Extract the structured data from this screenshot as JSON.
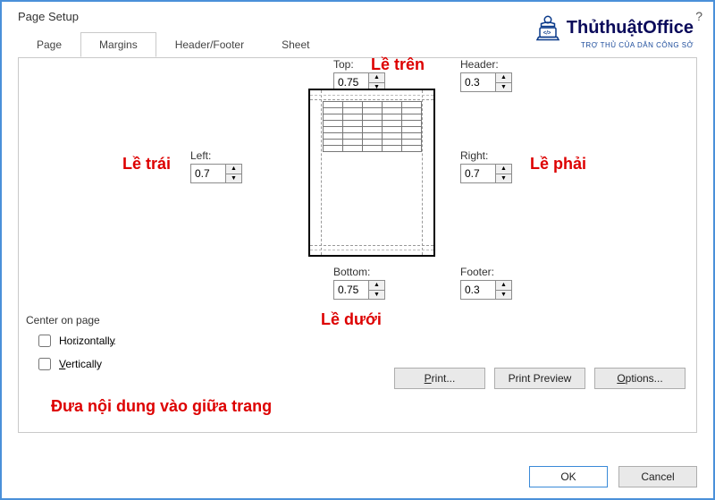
{
  "window": {
    "title": "Page Setup",
    "help": "?",
    "close": "✕"
  },
  "logo": {
    "brand": "ThủthuậtOffice",
    "tagline": "TRỢ THỦ CỦA DÂN CÔNG SỞ"
  },
  "tabs": {
    "page": "Page",
    "margins": "Margins",
    "headerfooter": "Header/Footer",
    "sheet": "Sheet"
  },
  "fields": {
    "top": {
      "label": "Top:",
      "value": "0.75"
    },
    "header": {
      "label": "Header:",
      "value": "0.3"
    },
    "left": {
      "label": "Left:",
      "value": "0.7"
    },
    "right": {
      "label": "Right:",
      "value": "0.7"
    },
    "bottom": {
      "label": "Bottom:",
      "value": "0.75"
    },
    "footer": {
      "label": "Footer:",
      "value": "0.3"
    }
  },
  "annotations": {
    "top": "Lề trên",
    "left": "Lề trái",
    "right": "Lề phải",
    "bottom": "Lề dưới",
    "center": "Đưa nội dung vào giữa trang"
  },
  "center": {
    "legend": "Center on page",
    "horizontally": "Horizontally",
    "vertically": "Vertically"
  },
  "buttons": {
    "print": "Print...",
    "preview": "Print Preview",
    "options": "Options...",
    "ok": "OK",
    "cancel": "Cancel"
  }
}
